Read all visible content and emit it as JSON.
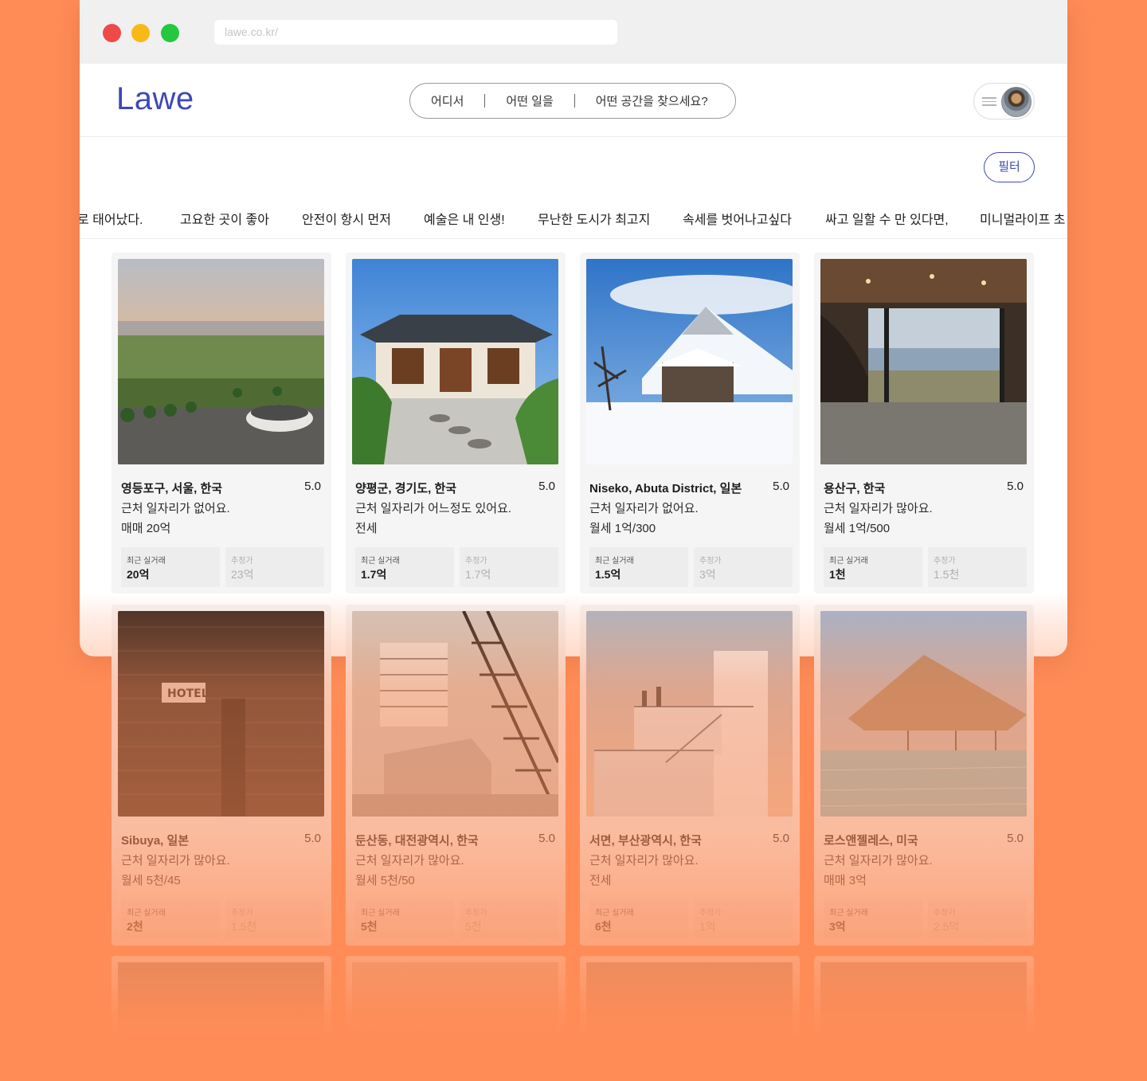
{
  "browser": {
    "url": "lawe.co.kr/"
  },
  "header": {
    "logo": "Lawe",
    "search": {
      "where": "어디서",
      "work": "어떤 일을",
      "space": "어떤 공간을 찾으세요?"
    },
    "menu_icon": "hamburger-icon",
    "avatar": "user-avatar"
  },
  "filter_label": "필터",
  "categories": [
    "로 태어났다.",
    "고요한 곳이 좋아",
    "안전이 항시 먼저",
    "예술은 내 인생!",
    "무난한 도시가 최고지",
    "속세를 벗어나고싶다",
    "싸고 일할 수 만 있다면,",
    "미니멀라이프 초"
  ],
  "stat_labels": {
    "recent": "최근 실거래",
    "estimate": "추정가"
  },
  "listings": [
    {
      "location": "영등포구, 서울, 한국",
      "rating": "5.0",
      "job": "근처 일자리가 없어요.",
      "price": "매매 20억",
      "recent": "20억",
      "estimate": "23억"
    },
    {
      "location": "양평군, 경기도, 한국",
      "rating": "5.0",
      "job": "근처 일자리가 어느정도 있어요.",
      "price": "전세",
      "recent": "1.7억",
      "estimate": "1.7억"
    },
    {
      "location": "Niseko, Abuta District, 일본",
      "rating": "5.0",
      "job": "근처 일자리가 없어요.",
      "price": "월세 1억/300",
      "recent": "1.5억",
      "estimate": "3억"
    },
    {
      "location": "용산구, 한국",
      "rating": "5.0",
      "job": "근처 일자리가 많아요.",
      "price": "월세 1억/500",
      "recent": "1천",
      "estimate": "1.5천"
    },
    {
      "location": "Sibuya, 일본",
      "rating": "5.0",
      "job": "근처 일자리가 많아요.",
      "price": "월세 5천/45",
      "recent": "2천",
      "estimate": "1.5천"
    },
    {
      "location": "둔산동, 대전광역시, 한국",
      "rating": "5.0",
      "job": "근처 일자리가 많아요.",
      "price": "월세 5천/50",
      "recent": "5천",
      "estimate": "5천"
    },
    {
      "location": "서면, 부산광역시, 한국",
      "rating": "5.0",
      "job": "근처 일자리가 많아요.",
      "price": "전세",
      "recent": "6천",
      "estimate": "1억"
    },
    {
      "location": "로스앤젤레스, 미국",
      "rating": "5.0",
      "job": "근처 일자리가 많아요.",
      "price": "매매 3억",
      "recent": "3억",
      "estimate": "2.5억"
    }
  ],
  "colors": {
    "background": "#FF8C57",
    "brand": "#3D49B6"
  }
}
